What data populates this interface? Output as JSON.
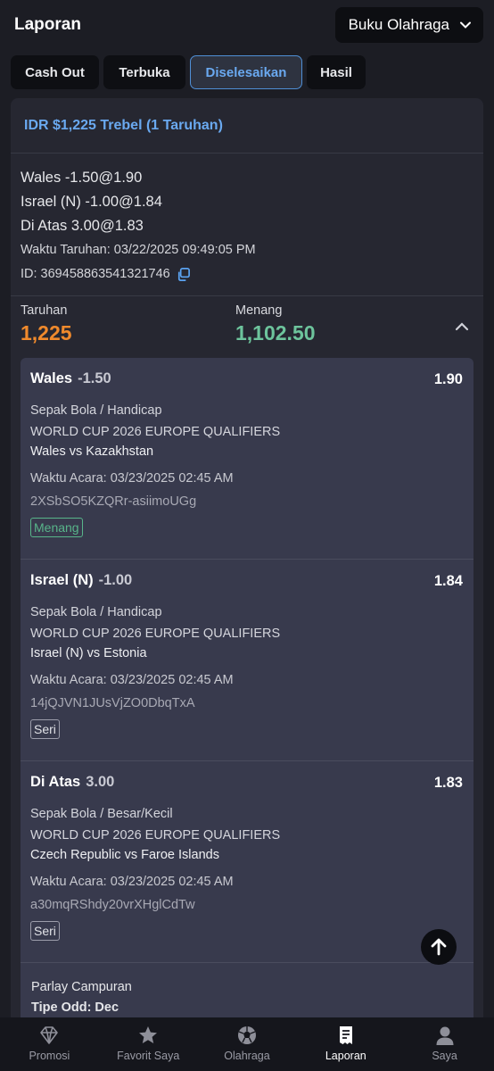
{
  "header": {
    "title": "Laporan",
    "dropdown_label": "Buku Olahraga"
  },
  "tabs": [
    {
      "label": "Cash Out",
      "active": false
    },
    {
      "label": "Terbuka",
      "active": false
    },
    {
      "label": "Diselesaikan",
      "active": true
    },
    {
      "label": "Hasil",
      "active": false
    }
  ],
  "bet": {
    "title": "IDR $1,225 Trebel (1 Taruhan)",
    "summary_legs": [
      "Wales -1.50@1.90",
      "Israel (N) -1.00@1.84",
      "Di Atas 3.00@1.83"
    ],
    "bet_time": "Waktu Taruhan: 03/22/2025 09:49:05 PM",
    "bet_id": "ID: 369458863541321746",
    "stake_label": "Taruhan",
    "stake_value": "1,225",
    "win_label": "Menang",
    "win_value": "1,102.50",
    "legs": [
      {
        "name": "Wales",
        "handicap": "-1.50",
        "odds": "1.90",
        "sport": "Sepak Bola / Handicap",
        "league": "WORLD CUP 2026 EUROPE QUALIFIERS",
        "match": "Wales vs Kazakhstan",
        "event_time": "Waktu Acara: 03/23/2025 02:45 AM",
        "code": "2XSbSO5KZQRr-asiimoUGg",
        "result": "Menang"
      },
      {
        "name": "Israel (N)",
        "handicap": "-1.00",
        "odds": "1.84",
        "sport": "Sepak Bola / Handicap",
        "league": "WORLD CUP 2026 EUROPE QUALIFIERS",
        "match": "Israel (N) vs Estonia",
        "event_time": "Waktu Acara: 03/23/2025 02:45 AM",
        "code": "14jQJVN1JUsVjZO0DbqTxA",
        "result": "Seri"
      },
      {
        "name": "Di Atas",
        "handicap": "3.00",
        "odds": "1.83",
        "sport": "Sepak Bola / Besar/Kecil",
        "league": "WORLD CUP 2026 EUROPE QUALIFIERS",
        "match": "Czech Republic vs Faroe Islands",
        "event_time": "Waktu Acara: 03/23/2025 02:45 AM",
        "code": "a30mqRShdy20vrXHglCdTw",
        "result": "Seri"
      }
    ],
    "parlay_type": "Parlay Campuran",
    "odds_type": "Tipe Odd:  Dec"
  },
  "nav": [
    {
      "label": "Promosi",
      "icon": "diamond-icon",
      "active": false
    },
    {
      "label": "Favorit Saya",
      "icon": "star-icon",
      "active": false
    },
    {
      "label": "Olahraga",
      "icon": "soccer-ball-icon",
      "active": false
    },
    {
      "label": "Laporan",
      "icon": "receipt-icon",
      "active": true
    },
    {
      "label": "Saya",
      "icon": "user-icon",
      "active": false
    }
  ],
  "colors": {
    "accent": "#6aa9f0",
    "stake": "#f08a2c",
    "win": "#6dc49c",
    "background": "#1c1d24",
    "card": "#262731"
  }
}
